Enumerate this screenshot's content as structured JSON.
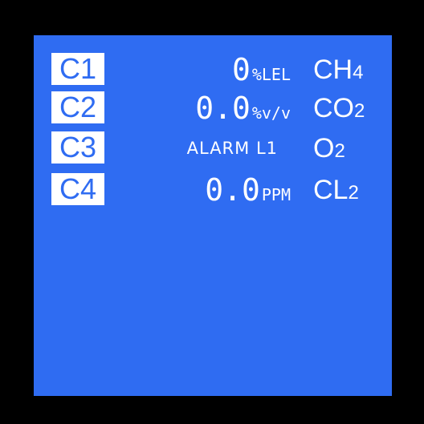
{
  "colors": {
    "bezel": "#000000",
    "screen": "#2f6cf2",
    "text": "#ffffff"
  },
  "channels": [
    {
      "label": "C1",
      "value": "0",
      "unit": "%LEL",
      "gas_symbol": "CH",
      "gas_sub": "4"
    },
    {
      "label": "C2",
      "value": "0.0",
      "unit": "%v/v",
      "gas_symbol": "CO",
      "gas_sub": "2"
    },
    {
      "label": "C3",
      "status": "ALARM L1",
      "gas_symbol": "O",
      "gas_sub": "2"
    },
    {
      "label": "C4",
      "value": "0.0",
      "unit": "PPM",
      "gas_symbol": "CL",
      "gas_sub": "2"
    }
  ]
}
